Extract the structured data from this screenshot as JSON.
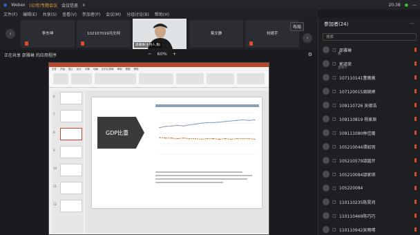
{
  "titlebar": {
    "app": "Webex",
    "meeting": "(公司)专题会议",
    "info": "会议信息",
    "time": "20:38",
    "sep": "∧"
  },
  "menu": [
    "文件(F)",
    "编辑(E)",
    "共享(S)",
    "查看(V)",
    "参加者(P)",
    "会议(M)",
    "分组讨论(B)",
    "帮助(H)"
  ],
  "tiles": [
    "李东坤",
    "102107019冯文柯",
    "",
    "蒋文静",
    "刘靖宇"
  ],
  "video_label": "邵雅琳(主持人,我)",
  "share": {
    "label": "正在共享 邵雅琳 的应用程序",
    "zoom_minus": "−",
    "zoom": "60%",
    "zoom_plus": "+"
  },
  "ppt": {
    "tabs": [
      "文件",
      "开始",
      "插入",
      "设计",
      "切换",
      "动画",
      "幻灯片放映",
      "审阅",
      "视图",
      "帮助"
    ],
    "slide_title": "GDP比重",
    "thumb_nums": [
      "6",
      "7",
      "8",
      "9",
      "10",
      "11",
      "12"
    ]
  },
  "panel": {
    "title": "参加者(24)",
    "search": "搜索",
    "layout_btn": "布局"
  },
  "participants": [
    {
      "name": "邵雅琳",
      "sub": "我"
    },
    {
      "name": "郭道荣",
      "sub": "主持人"
    },
    {
      "name": "107110141董薇薇",
      "sub": ""
    },
    {
      "name": "107120015周婉婷",
      "sub": ""
    },
    {
      "name": "109110726 吴德浩",
      "sub": ""
    },
    {
      "name": "109110819 杨家辰",
      "sub": ""
    },
    {
      "name": "109111080林佳璐",
      "sub": ""
    },
    {
      "name": "105210044谭如玥",
      "sub": ""
    },
    {
      "name": "105210579邵越开",
      "sub": ""
    },
    {
      "name": "105210084邵家琪",
      "sub": ""
    },
    {
      "name": "105220084",
      "sub": ""
    },
    {
      "name": "110110235陈昊鸿",
      "sub": ""
    },
    {
      "name": "110110469陈巧巧",
      "sub": ""
    },
    {
      "name": "110110942吴雨晴",
      "sub": ""
    }
  ],
  "chart_data": {
    "type": "line",
    "title": "",
    "series": [
      {
        "name": "",
        "values": [
          58,
          60,
          61,
          62,
          61,
          63,
          64,
          66,
          67,
          67,
          68,
          69,
          70,
          71,
          72,
          71,
          72
        ]
      },
      {
        "name": "",
        "values": [
          40,
          39,
          39,
          38,
          39,
          38,
          38,
          37,
          38,
          38,
          37,
          38,
          37,
          38,
          38,
          38,
          37
        ]
      }
    ],
    "colors": [
      "#8a9db5",
      "#c67a2b"
    ]
  }
}
